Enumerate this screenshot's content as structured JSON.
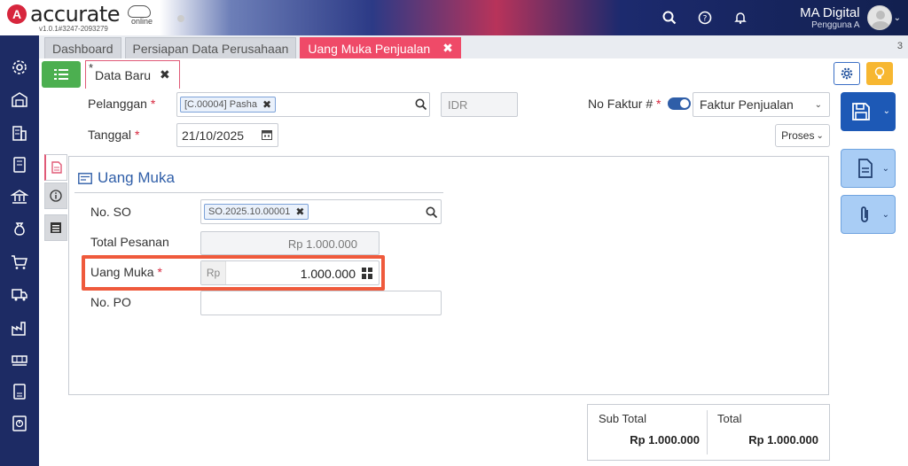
{
  "app": {
    "logo_letter": "A",
    "logo_text": "accurate",
    "logo_sub": "online",
    "version": "v1.0.1#3247-2093279"
  },
  "user": {
    "name": "MA Digital",
    "role": "Pengguna A"
  },
  "tabs": [
    {
      "label": "Dashboard"
    },
    {
      "label": "Persiapan Data Perusahaan"
    },
    {
      "label": "Uang Muka Penjualan",
      "close": "✖"
    }
  ],
  "tab_count": "3",
  "subtab": {
    "star": "*",
    "label": "Data Baru",
    "close": "✖"
  },
  "form": {
    "pelanggan_label": "Pelanggan",
    "required_mark": "*",
    "pelanggan_chip": "[C.00004] Pasha",
    "chip_close": "✖",
    "currency": "IDR",
    "no_faktur_label": "No Faktur #",
    "faktur_select": "Faktur Penjualan",
    "tanggal_label": "Tanggal",
    "tanggal_value": "21/10/2025",
    "proses_label": "Proses",
    "proses_chevron": "⌄"
  },
  "section": {
    "title": "Uang Muka",
    "no_so_label": "No. SO",
    "no_so_chip": "SO.2025.10.00001",
    "total_pesanan_label": "Total Pesanan",
    "total_pesanan_value": "Rp 1.000.000",
    "uang_muka_label": "Uang Muka",
    "uang_muka_prefix": "Rp",
    "uang_muka_value": "1.000.000",
    "no_po_label": "No. PO",
    "no_po_value": ""
  },
  "totals": {
    "sub_total_label": "Sub Total",
    "sub_total_value": "Rp 1.000.000",
    "total_label": "Total",
    "total_value": "Rp 1.000.000"
  },
  "colors": {
    "sidebar": "#1d2b64",
    "active_tab": "#ef4a68",
    "primary": "#1d59b6",
    "highlight": "#ef5a3c",
    "list_button": "#4caf50"
  },
  "icons": {
    "sidebar": [
      "settings-icon",
      "warehouse-icon",
      "building-icon",
      "book-icon",
      "bank-icon",
      "money-bag-icon",
      "cart-icon",
      "truck-icon",
      "factory-icon",
      "pallet-icon",
      "tax-icon",
      "report-icon"
    ]
  }
}
